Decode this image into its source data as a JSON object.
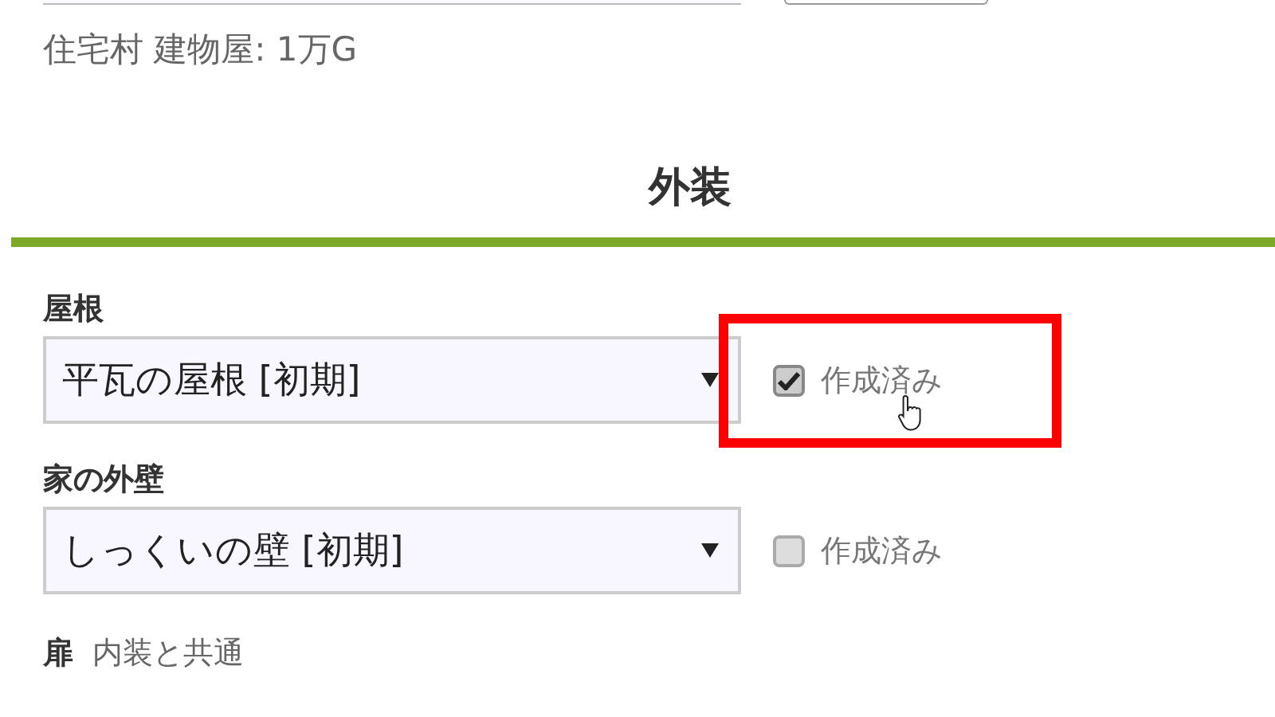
{
  "info_text": "住宅村 建物屋: 1万G",
  "section_title": "外装",
  "fields": [
    {
      "label": "屋根",
      "value": "平瓦の屋根 [初期]",
      "built_label": "作成済み",
      "checked": true,
      "highlighted": true,
      "hovered": true
    },
    {
      "label": "家の外壁",
      "value": "しっくいの壁 [初期]",
      "built_label": "作成済み",
      "checked": false,
      "highlighted": false,
      "hovered": false
    }
  ],
  "door": {
    "label": "扉",
    "note": "内装と共通"
  }
}
